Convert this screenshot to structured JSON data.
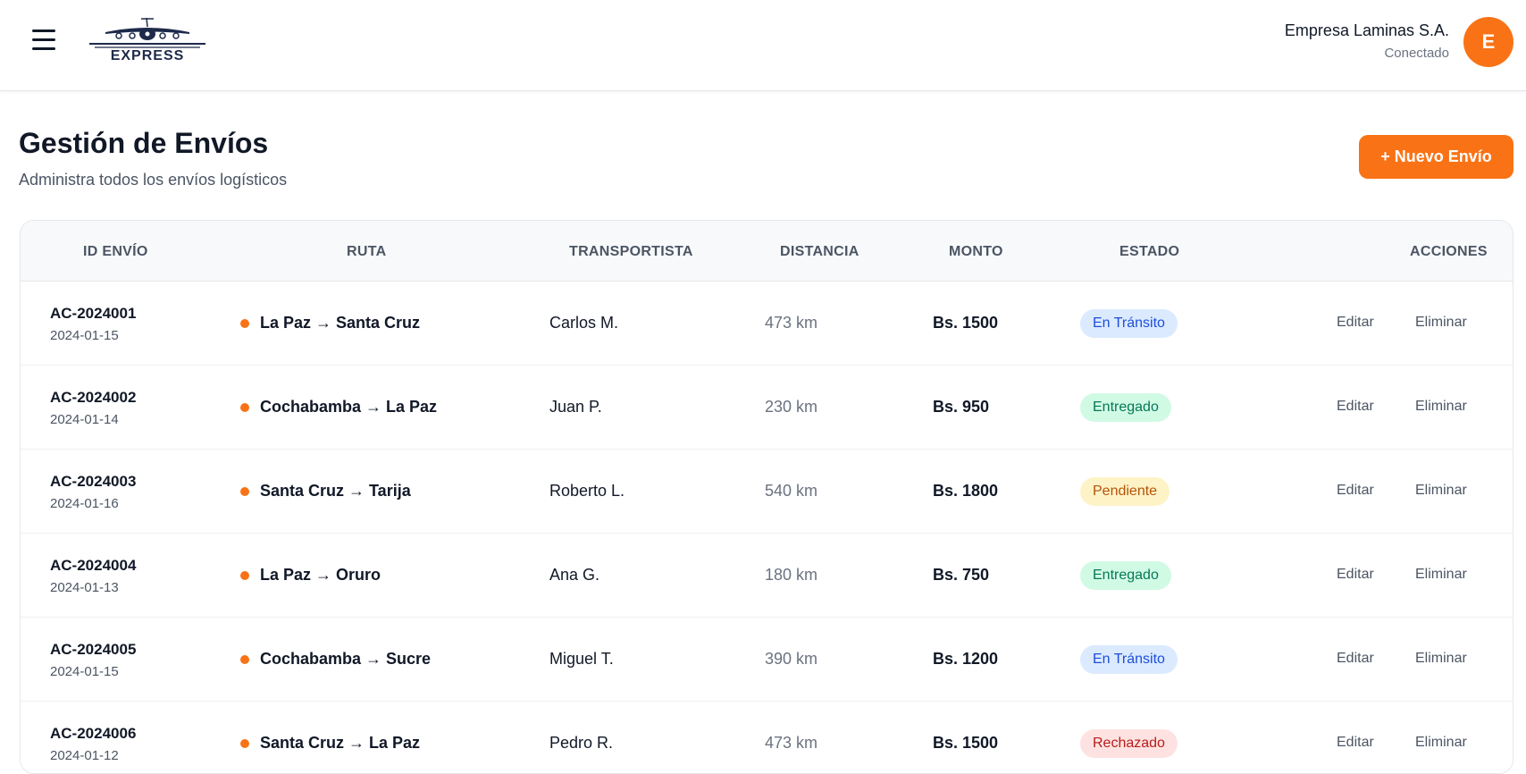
{
  "header": {
    "logo_text": "EXPRESS",
    "user_name": "Empresa Laminas S.A.",
    "user_status": "Conectado",
    "avatar_letter": "E"
  },
  "page": {
    "title": "Gestión de Envíos",
    "subtitle": "Administra todos los envíos logísticos",
    "new_button": "+ Nuevo Envío"
  },
  "table": {
    "columns": [
      "ID ENVÍO",
      "RUTA",
      "TRANSPORTISTA",
      "DISTANCIA",
      "MONTO",
      "ESTADO",
      "ACCIONES"
    ],
    "edit_label": "Editar",
    "delete_label": "Eliminar",
    "rows": [
      {
        "id": "AC-2024001",
        "date": "2024-01-15",
        "route": "La Paz → Santa Cruz",
        "carrier": "Carlos M.",
        "distance": "473 km",
        "amount": "Bs. 1500",
        "status": "En Tránsito",
        "status_type": "transit"
      },
      {
        "id": "AC-2024002",
        "date": "2024-01-14",
        "route": "Cochabamba → La Paz",
        "carrier": "Juan P.",
        "distance": "230 km",
        "amount": "Bs. 950",
        "status": "Entregado",
        "status_type": "delivered"
      },
      {
        "id": "AC-2024003",
        "date": "2024-01-16",
        "route": "Santa Cruz → Tarija",
        "carrier": "Roberto L.",
        "distance": "540 km",
        "amount": "Bs. 1800",
        "status": "Pendiente",
        "status_type": "pending"
      },
      {
        "id": "AC-2024004",
        "date": "2024-01-13",
        "route": "La Paz → Oruro",
        "carrier": "Ana G.",
        "distance": "180 km",
        "amount": "Bs. 750",
        "status": "Entregado",
        "status_type": "delivered"
      },
      {
        "id": "AC-2024005",
        "date": "2024-01-15",
        "route": "Cochabamba → Sucre",
        "carrier": "Miguel T.",
        "distance": "390 km",
        "amount": "Bs. 1200",
        "status": "En Tránsito",
        "status_type": "transit"
      },
      {
        "id": "AC-2024006",
        "date": "2024-01-12",
        "route": "Santa Cruz → La Paz",
        "carrier": "Pedro R.",
        "distance": "473 km",
        "amount": "Bs. 1500",
        "status": "Rechazado",
        "status_type": "rejected"
      }
    ]
  },
  "colors": {
    "accent": "#f97316",
    "transit_bg": "#dbeafe",
    "delivered_bg": "#d1fae5",
    "pending_bg": "#fef3c7",
    "rejected_bg": "#fee2e2"
  },
  "icons": [
    "hamburger-menu-icon",
    "airplane-logo-icon",
    "route-dot-icon"
  ]
}
